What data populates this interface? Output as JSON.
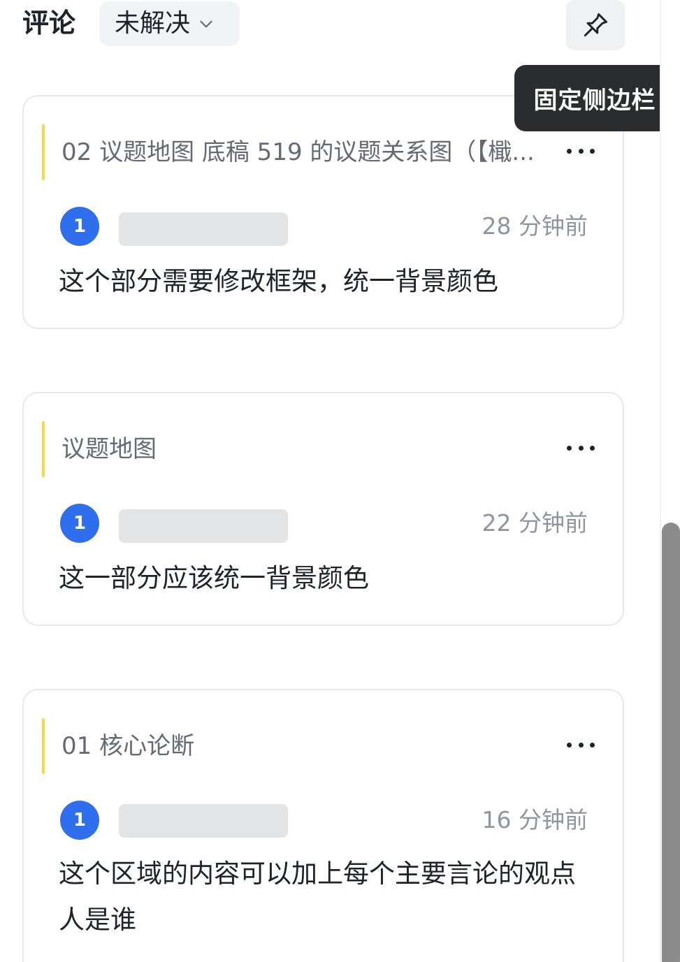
{
  "header": {
    "title": "评论",
    "filter_label": "未解决",
    "tooltip": "固定侧边栏"
  },
  "comments": [
    {
      "quote": "02 议题地图 底稿 519 的议题关系图（【檝...",
      "avatar_label": "1",
      "time": "28 分钟前",
      "text": "这个部分需要修改框架，统一背景颜色"
    },
    {
      "quote": "议题地图",
      "avatar_label": "1",
      "time": "22 分钟前",
      "text": "这一部分应该统一背景颜色"
    },
    {
      "quote": "01 核心论断",
      "avatar_label": "1",
      "time": "16 分钟前",
      "text": "这个区域的内容可以加上每个主要言论的观点人是谁"
    }
  ],
  "colors": {
    "accent": "#2f6fed",
    "quote_bar": "#f2d94c",
    "tooltip_bg": "#2b2c2e"
  }
}
